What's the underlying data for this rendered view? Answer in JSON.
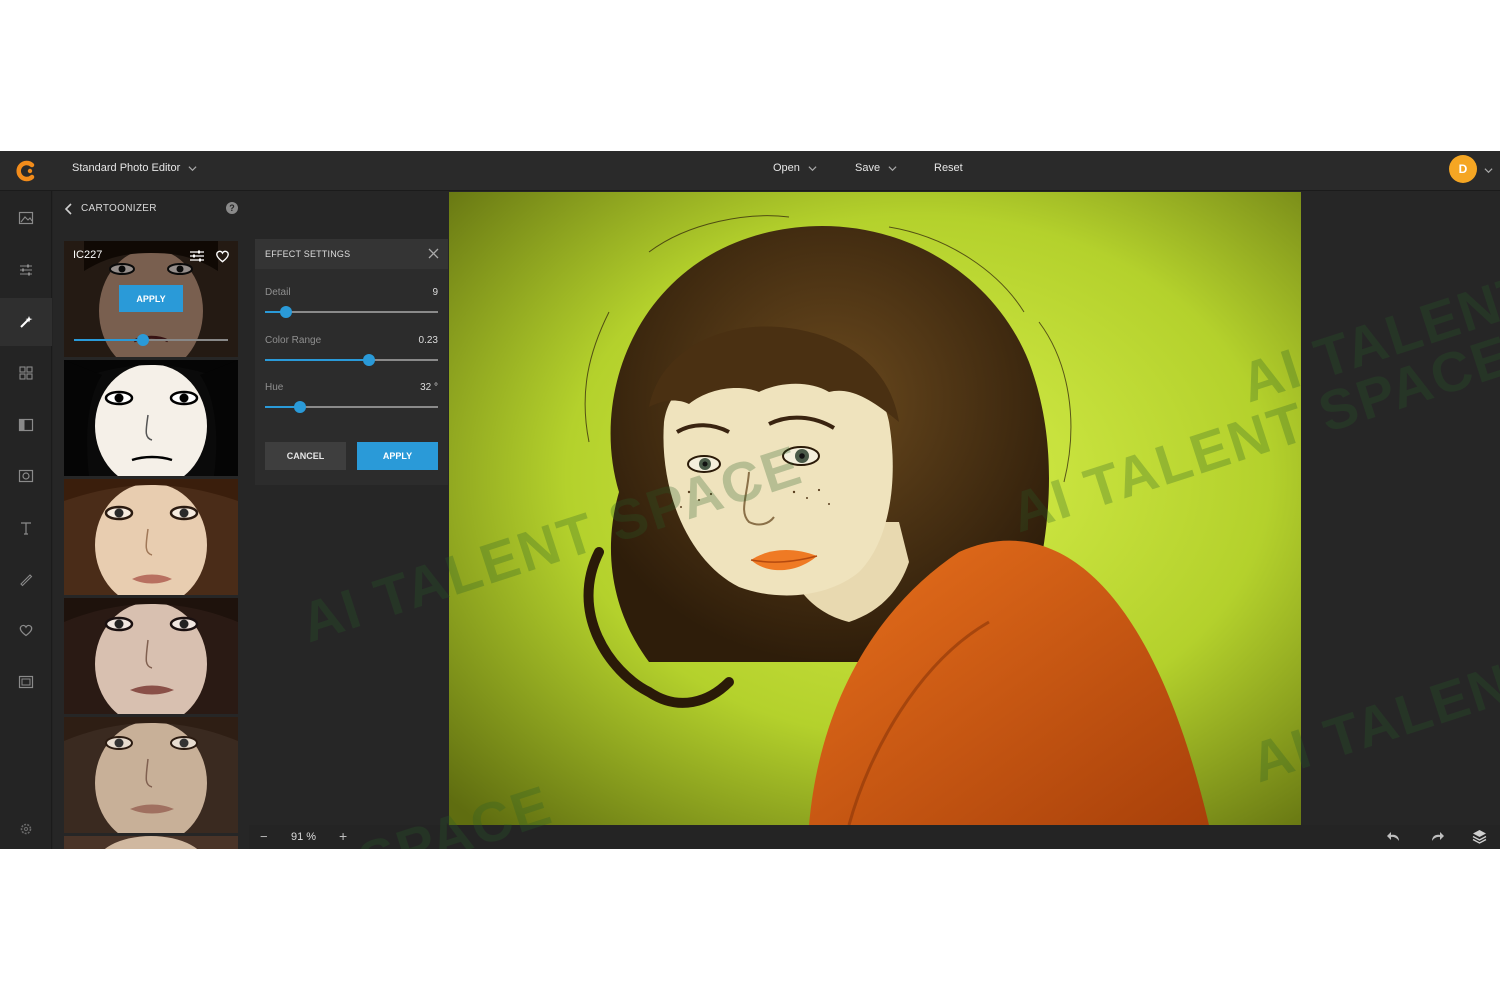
{
  "header": {
    "editor_mode": "Standard Photo Editor",
    "menu": {
      "open": "Open",
      "save": "Save",
      "reset": "Reset"
    },
    "avatar_initial": "D"
  },
  "filter_panel": {
    "title": "CARTOONIZER",
    "help": "?",
    "selected_preset": {
      "name": "IC227",
      "apply_label": "APPLY",
      "intensity": 0.45
    },
    "thumbnails": [
      "cartoon-preset-1",
      "cartoon-preset-2",
      "cartoon-preset-3",
      "cartoon-preset-4",
      "cartoon-preset-5"
    ]
  },
  "effect_settings": {
    "title": "EFFECT SETTINGS",
    "sliders": [
      {
        "label": "Detail",
        "value": "9",
        "fraction": 0.12
      },
      {
        "label": "Color Range",
        "value": "0.23",
        "fraction": 0.6
      },
      {
        "label": "Hue",
        "value": "32 °",
        "fraction": 0.2
      }
    ],
    "cancel_label": "CANCEL",
    "apply_label": "APPLY"
  },
  "bottom_bar": {
    "zoom_out": "−",
    "zoom_level": "91 %",
    "zoom_in": "+"
  },
  "watermark": {
    "text": "AI TALENT SPACE"
  },
  "colors": {
    "accent": "#2a9ad8",
    "avatar": "#f5a623",
    "logo": "#f28c1b"
  },
  "icons": [
    "logo-icon",
    "image-icon",
    "adjust-icon",
    "effects-icon",
    "grid-icon",
    "frame-icon",
    "camera-icon",
    "text-icon",
    "brush-icon",
    "heart-icon",
    "layers-icon",
    "settings-icon",
    "undo-icon",
    "redo-icon"
  ]
}
